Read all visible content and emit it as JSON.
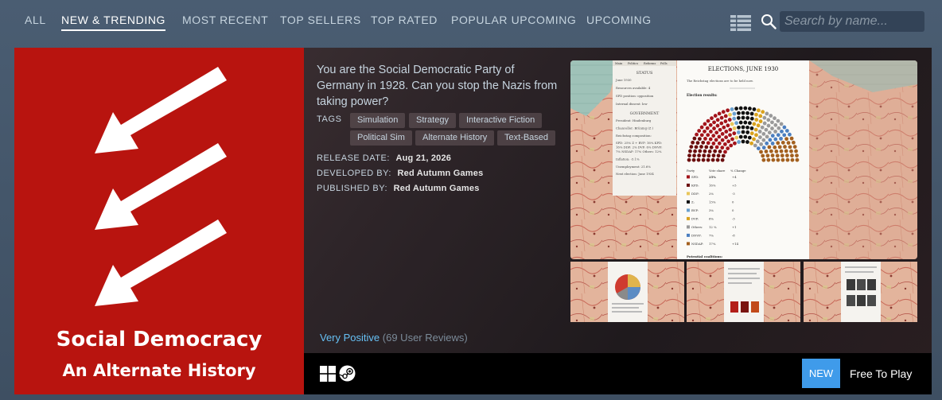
{
  "nav": {
    "tabs": [
      {
        "label": "ALL"
      },
      {
        "label": "NEW & TRENDING"
      },
      {
        "label": "MOST RECENT"
      },
      {
        "label": "TOP SELLERS"
      },
      {
        "label": "TOP RATED"
      },
      {
        "label": "POPULAR UPCOMING"
      },
      {
        "label": "UPCOMING"
      }
    ],
    "active_tab": "NEW & TRENDING",
    "search_placeholder": "Search by name..."
  },
  "game": {
    "capsule_title_line1": "Social Democracy",
    "capsule_title_line2": "An Alternate History",
    "description": "You are the Social Democratic Party of Germany in 1928. Can you stop the Nazis from taking power?",
    "tags_label": "TAGS",
    "tags": [
      "Simulation",
      "Strategy",
      "Interactive Fiction",
      "Political Sim",
      "Alternate History",
      "Text-Based"
    ],
    "release_label": "RELEASE DATE:",
    "release_date": "Aug 21, 2026",
    "developer_label": "DEVELOPED BY:",
    "developer": "Red Autumn Games",
    "publisher_label": "PUBLISHED BY:",
    "publisher": "Red Autumn Games",
    "review_summary": "Very Positive",
    "review_count": "(69 User Reviews)",
    "badge": "NEW",
    "price": "Free To Play"
  },
  "screenshot": {
    "tabs": [
      "Main",
      "Politics",
      "Reforms",
      "Polls"
    ],
    "status_heading": "STATUS",
    "status_lines": [
      "June 1930",
      "Resources available: 4",
      "SPD position: opposition",
      "Internal dissent: low"
    ],
    "gov_heading": "GOVERNMENT",
    "gov_lines": [
      "President: Hindenburg",
      "Chancellor: Brüning (Z )",
      "Reichstag composition:",
      "SPD: 25% Z + BVP: 16% KPD: 16% DDP: 2% DVP: 6% DNVP: 7% NSDAP: 17% Others: 12%",
      "Inflation: -5.1%",
      "Unemployment: 21.6%",
      "Next election: June 1934"
    ],
    "election_title": "ELECTIONS, JUNE 1930",
    "election_subtitle": "The Reichstag elections are to be held now.",
    "results_heading": "Election results:",
    "table_headers": [
      "Party",
      "Vote share",
      "% Change"
    ],
    "parties": [
      {
        "name": "SPD:",
        "share": "25%",
        "change": "+4",
        "color": "#a3141b"
      },
      {
        "name": "KPD:",
        "share": "16%",
        "change": "+5",
        "color": "#6b0e0e"
      },
      {
        "name": "DDP:",
        "share": "2%",
        "change": "-3",
        "color": "#e8c65a"
      },
      {
        "name": "Z:",
        "share": "13%",
        "change": "0",
        "color": "#111111"
      },
      {
        "name": "BVP:",
        "share": "3%",
        "change": "0",
        "color": "#6aa0cf"
      },
      {
        "name": "DVP:",
        "share": "6%",
        "change": "-3",
        "color": "#d9a21e"
      },
      {
        "name": "Others:",
        "share": "12 %",
        "change": "+1",
        "color": "#9a9a9a"
      },
      {
        "name": "DNVP:",
        "share": "7%",
        "change": "-8",
        "color": "#4c7fc0"
      },
      {
        "name": "NSDAP:",
        "share": "17%",
        "change": "+14",
        "color": "#a3601f"
      }
    ],
    "coalitions_heading": "Potential coalitions:"
  }
}
